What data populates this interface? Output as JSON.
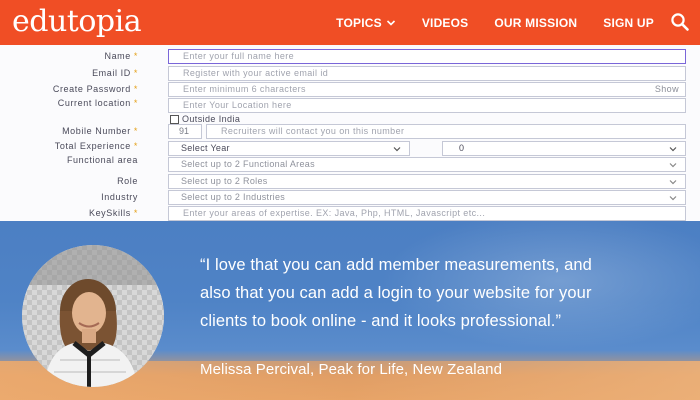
{
  "header": {
    "logo": "edutopia",
    "nav": {
      "topics": "TOPICS",
      "videos": "VIDEOS",
      "mission": "OUR MISSION",
      "signup": "SIGN UP"
    },
    "colors": {
      "brand": "#f04e25"
    }
  },
  "form": {
    "name": {
      "label": "Name",
      "placeholder": "Enter your full name here"
    },
    "email": {
      "label": "Email ID",
      "placeholder": "Register with your active email id"
    },
    "password": {
      "label": "Create Password",
      "placeholder": "Enter minimum 6 characters",
      "show": "Show"
    },
    "location": {
      "label": "Current location",
      "placeholder": "Enter Your Location here"
    },
    "outside_india": "Outside India",
    "mobile": {
      "label": "Mobile Number",
      "code": "91",
      "placeholder": "Recruiters will contact you on this number"
    },
    "experience": {
      "label": "Total Experience",
      "year": "Select Year",
      "month": "0"
    },
    "functional_area": {
      "label": "Functional area",
      "placeholder": "Select up to 2 Functional Areas"
    },
    "role": {
      "label": "Role",
      "placeholder": "Select up to 2 Roles"
    },
    "industry": {
      "label": "Industry",
      "placeholder": "Select up to 2 Industries"
    },
    "keyskills": {
      "label": "KeySkills",
      "placeholder": "Enter your areas of expertise. EX: Java, Php, HTML, Javascript etc..."
    },
    "required_mark": "*",
    "colors": {
      "required": "#e4a11b",
      "active_border": "#7a66d9"
    }
  },
  "testimonial": {
    "quote_line1": "“I love that you can add member measurements, and",
    "quote_line2": "also that you can add a login to your website for your",
    "quote_line3": "clients to book online - and it looks professional.”",
    "author": "Melissa Percival, Peak for Life, New Zealand"
  }
}
